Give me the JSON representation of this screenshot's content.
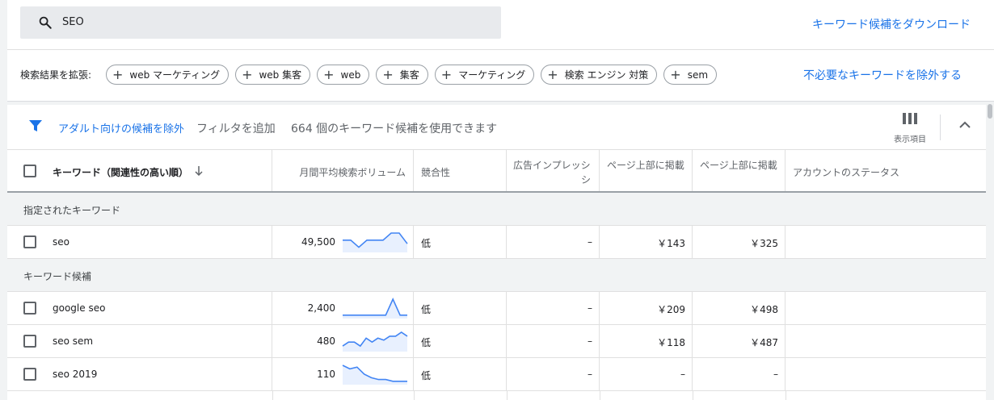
{
  "search": {
    "query": "SEO"
  },
  "download_link": "キーワード候補をダウンロード",
  "expand": {
    "label": "検索結果を拡張:",
    "chips": [
      "web マーケティング",
      "web 集客",
      "web",
      "集客",
      "マーケティング",
      "検索 エンジン 対策",
      "sem"
    ]
  },
  "exclude_link": "不必要なキーワードを除外する",
  "filterbar": {
    "adult_link": "アダルト向けの候補を除外",
    "add_filter": "フィルタを追加",
    "count_text": "664 個のキーワード候補を使用できます",
    "columns_label": "表示項目"
  },
  "table": {
    "headers": {
      "keyword": "キーワード（関連性の高い順）",
      "volume": "月間平均検索ボリューム",
      "competition": "競合性",
      "impression_line1": "広告インプレッシ",
      "impression_line2": "シ",
      "top_low": "ページ上部に掲載",
      "top_high": "ページ上部に掲載",
      "account_status": "アカウントのステータス"
    },
    "section_specified": "指定されたキーワード",
    "section_ideas": "キーワード候補",
    "specified_row": {
      "keyword": "seo",
      "volume": "49,500",
      "competition": "低",
      "impression": "–",
      "bid_low": "￥143",
      "bid_high": "￥325",
      "trend": [
        6,
        6,
        2,
        6,
        6,
        6,
        10,
        10,
        4
      ]
    },
    "idea_rows": [
      {
        "keyword": "google seo",
        "volume": "2,400",
        "competition": "低",
        "impression": "–",
        "bid_low": "￥209",
        "bid_high": "￥498",
        "trend": [
          1,
          1,
          1,
          1,
          1,
          1,
          1,
          10,
          1,
          1
        ]
      },
      {
        "keyword": "seo sem",
        "volume": "480",
        "competition": "低",
        "impression": "–",
        "bid_low": "￥118",
        "bid_high": "￥487",
        "trend": [
          2,
          4,
          4,
          2,
          6,
          4,
          6,
          5,
          7,
          7,
          9,
          7
        ]
      },
      {
        "keyword": "seo 2019",
        "volume": "110",
        "competition": "低",
        "impression": "–",
        "bid_low": "–",
        "bid_high": "–",
        "trend": [
          10,
          8,
          9,
          5,
          3,
          2,
          2,
          1,
          1,
          1
        ]
      }
    ]
  },
  "colors": {
    "accent": "#1a73e8",
    "trend_line": "#4285f4",
    "trend_fill": "#e8f0fe"
  },
  "icons": [
    "search-icon",
    "filter-icon",
    "columns-icon",
    "collapse-icon",
    "plus-icon",
    "sort-arrow-icon"
  ]
}
